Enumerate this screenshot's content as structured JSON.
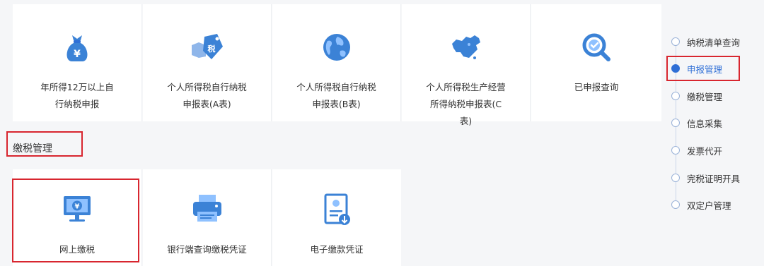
{
  "declare_cards": [
    {
      "label": "年所得12万以上自行纳税申报",
      "icon": "money-bag-icon"
    },
    {
      "label": "个人所得税自行纳税申报表(A表)",
      "icon": "tax-tag-hand-icon"
    },
    {
      "label": "个人所得税自行纳税申报表(B表)",
      "icon": "globe-icon"
    },
    {
      "label": "个人所得税生产经营所得纳税申报表(C表)",
      "icon": "china-map-icon"
    },
    {
      "label": "已申报查询",
      "icon": "search-check-icon"
    }
  ],
  "section_title": "缴税管理",
  "pay_cards": [
    {
      "label": "网上缴税",
      "icon": "monitor-yen-icon"
    },
    {
      "label": "银行端查询缴税凭证",
      "icon": "printer-icon"
    },
    {
      "label": "电子缴款凭证",
      "icon": "certificate-download-icon"
    }
  ],
  "timeline": [
    {
      "label": "纳税清单查询",
      "active": false
    },
    {
      "label": "申报管理",
      "active": true
    },
    {
      "label": "缴税管理",
      "active": false
    },
    {
      "label": "信息采集",
      "active": false
    },
    {
      "label": "发票代开",
      "active": false
    },
    {
      "label": "完税证明开具",
      "active": false
    },
    {
      "label": "双定户管理",
      "active": false
    }
  ],
  "colors": {
    "accent": "#2f6fd6",
    "icon_blue": "#3b82d6",
    "highlight_red": "#d8262f"
  }
}
